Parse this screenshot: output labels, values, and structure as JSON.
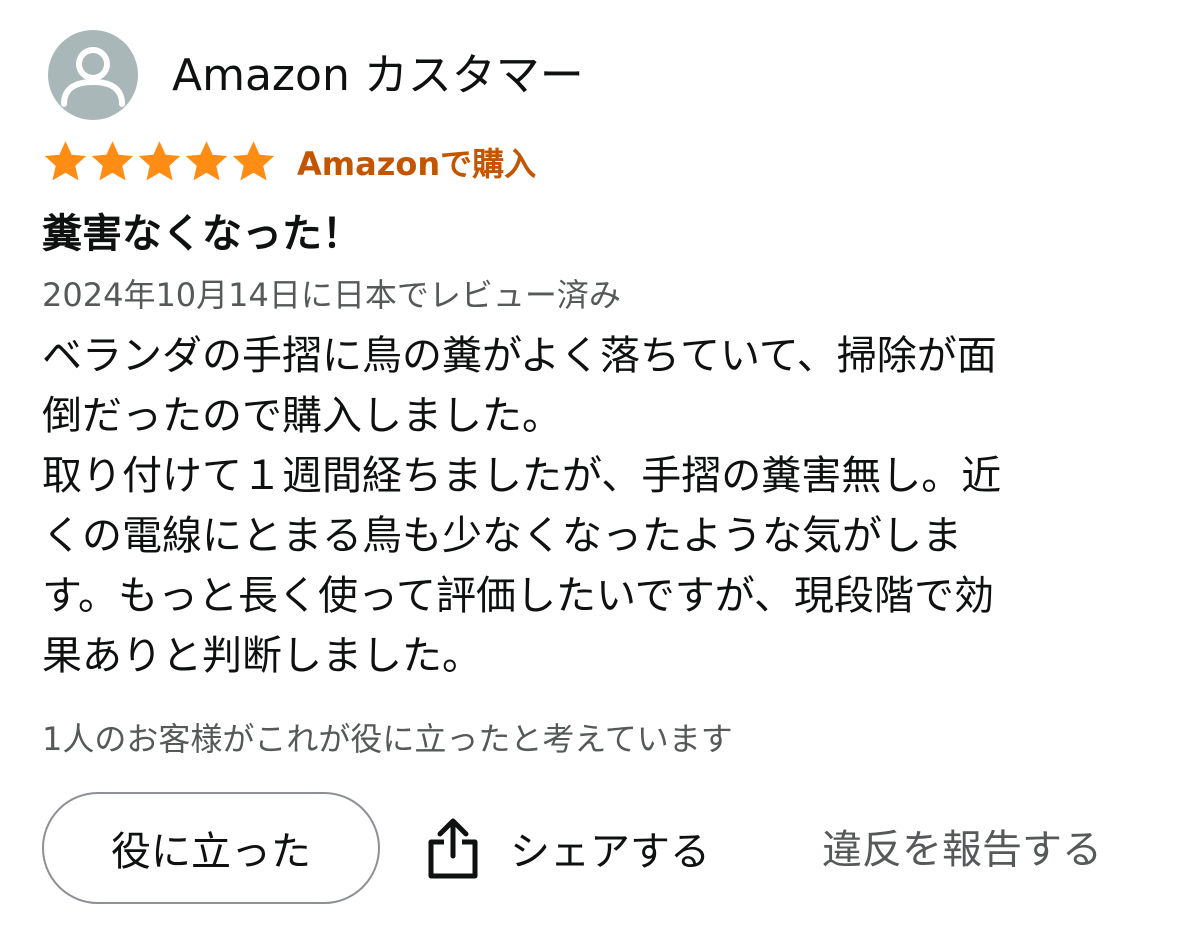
{
  "reviewer": {
    "name": "Amazon カスタマー",
    "avatar_icon": "person-silhouette-icon"
  },
  "rating": {
    "stars": 5,
    "max_stars": 5,
    "star_icon": "star-icon",
    "star_color": "#ff8c14",
    "verified_label": "Amazonで購入",
    "verified_color": "#c45500"
  },
  "review": {
    "title": "糞害なくなった！",
    "date_text": "2024年10月14日に日本でレビュー済み",
    "body_lines": [
      "ベランダの手摺に鳥の糞がよく落ちていて、掃除が面",
      "倒だったので購入しました。",
      "取り付けて１週間経ちましたが、手摺の糞害無し。近",
      "くの電線にとまる鳥も少なくなったような気がしま",
      "す。もっと長く使って評価したいですが、現段階で効",
      "果ありと判断しました。"
    ]
  },
  "helpful": {
    "count_text": "1人のお客様がこれが役に立ったと考えています",
    "button_label": "役に立った"
  },
  "actions": {
    "share_label": "シェアする",
    "share_icon": "share-icon",
    "report_label": "違反を報告する"
  }
}
